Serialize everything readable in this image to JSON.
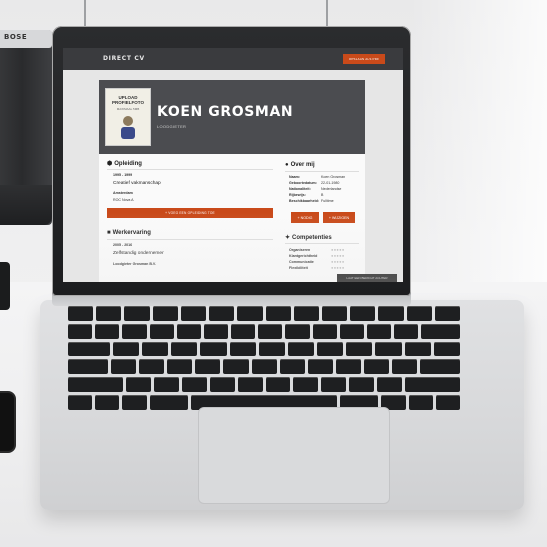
{
  "speaker": {
    "brand": "BOSE"
  },
  "site": {
    "logo": "DIRECT CV",
    "top_button": "OPSLAAN ALS PDF",
    "profile": {
      "photo_line1": "UPLOAD",
      "photo_line2": "PROFIELFOTO",
      "photo_line3": "MAXIMAAL 5MB",
      "name": "KOEN GROSMAN",
      "role": "LOODGIETER"
    },
    "education": {
      "title": "Opleiding",
      "years": "1995 - 1999",
      "degree": "Creatief vakmanschap",
      "place": "Amsterdam",
      "school": "ROC Nova A",
      "upload_bar": "+ VOEG EEN OPLEIDING TOE"
    },
    "work": {
      "title": "Werkervaring",
      "years": "2005 - 2016",
      "job": "Zelfstandig ondernemer",
      "company": "Loodgieter Grosman B.V."
    },
    "about": {
      "title": "Over mij",
      "fields": [
        {
          "label": "Naam:",
          "value": "Koen Grosman"
        },
        {
          "label": "Geboortedatum:",
          "value": "22-01-1980"
        },
        {
          "label": "Nationaliteit:",
          "value": "Nederlandse"
        },
        {
          "label": "Rijbewijs:",
          "value": "B"
        },
        {
          "label": "Beschikbaarheid:",
          "value": "Fulltime"
        }
      ],
      "btn_add": "+ NODIG",
      "btn_more": "+ WIJZIGEN"
    },
    "skills": {
      "title": "Competenties",
      "items": [
        "Organiseren",
        "Klantgerichtheid",
        "Communicatie",
        "Flexibiliteit"
      ]
    },
    "chat": "LAAT EEN BERICHT ACHTER"
  },
  "colors": {
    "accent": "#c94a1a",
    "header": "#4b4c50",
    "topbar": "#3a3b3e"
  }
}
